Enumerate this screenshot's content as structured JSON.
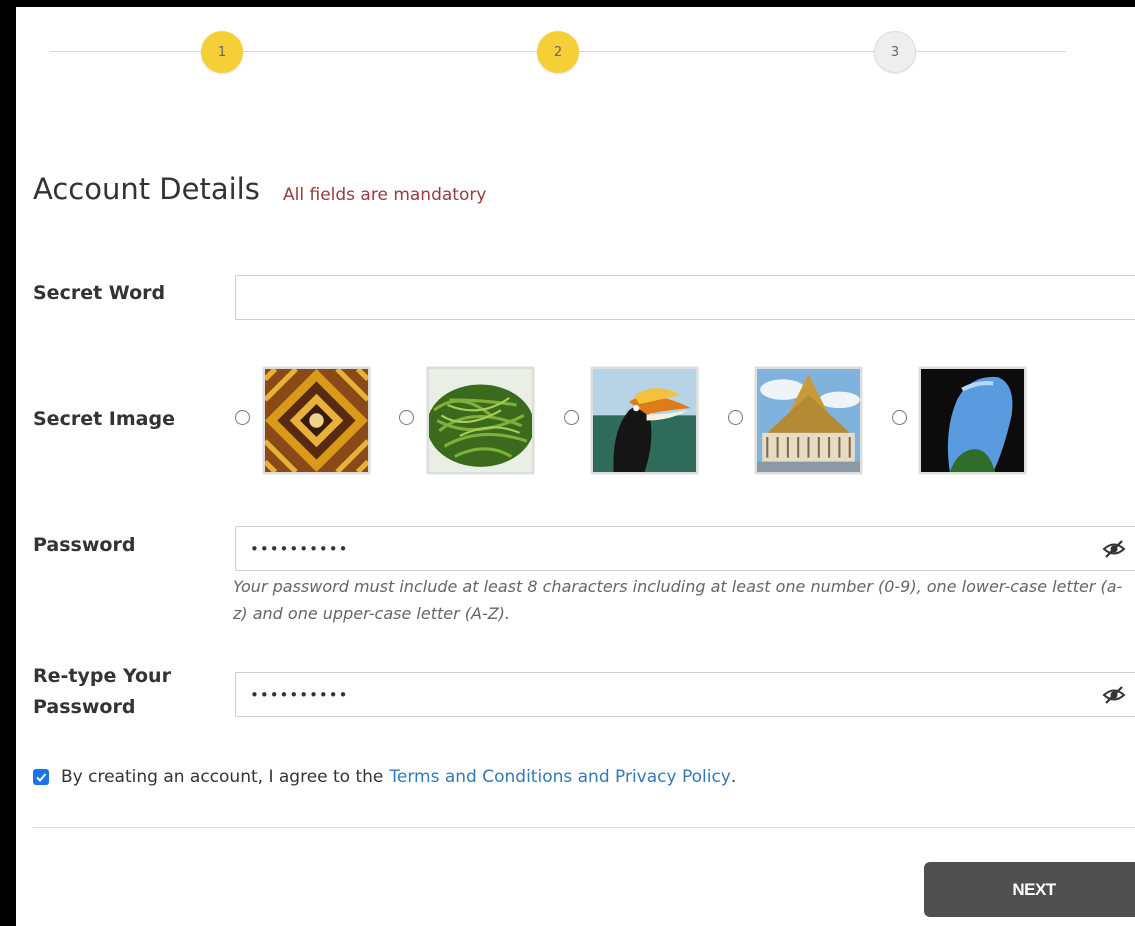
{
  "stepper": {
    "steps": [
      {
        "label": "1",
        "state": "completed"
      },
      {
        "label": "2",
        "state": "active"
      },
      {
        "label": "3",
        "state": "inactive"
      }
    ]
  },
  "header": {
    "title": "Account Details",
    "mandatory_note": "All fields are mandatory"
  },
  "form": {
    "secret_word": {
      "label": "Secret Word",
      "value": ""
    },
    "secret_image": {
      "label": "Secret Image",
      "options": [
        {
          "icon": "tribal-pattern-image",
          "selected": false
        },
        {
          "icon": "green-vegetables-image",
          "selected": false
        },
        {
          "icon": "hornbill-bird-image",
          "selected": false
        },
        {
          "icon": "golden-roof-building-image",
          "selected": false
        },
        {
          "icon": "cave-opening-image",
          "selected": false
        }
      ]
    },
    "password": {
      "label": "Password",
      "value": "••••••••••",
      "hint": "Your password must include at least 8 characters including at least one number (0-9), one lower-case letter (a-z) and one upper-case letter (A-Z)."
    },
    "retype_password": {
      "label_line1": "Re-type Your",
      "label_line2": "Password",
      "value": "••••••••••"
    }
  },
  "agreement": {
    "checked": true,
    "text_before": "By creating an account, I agree to the",
    "link_text": "Terms and Conditions and Privacy Policy",
    "text_after": "."
  },
  "actions": {
    "next_label": "NEXT"
  },
  "colors": {
    "step_active": "#f5cf35",
    "step_inactive": "#eeeeee",
    "mandatory_text": "#9c3a3a",
    "link": "#3479b7",
    "checkbox": "#1a73e8",
    "button_bg": "#4f4f4f"
  }
}
